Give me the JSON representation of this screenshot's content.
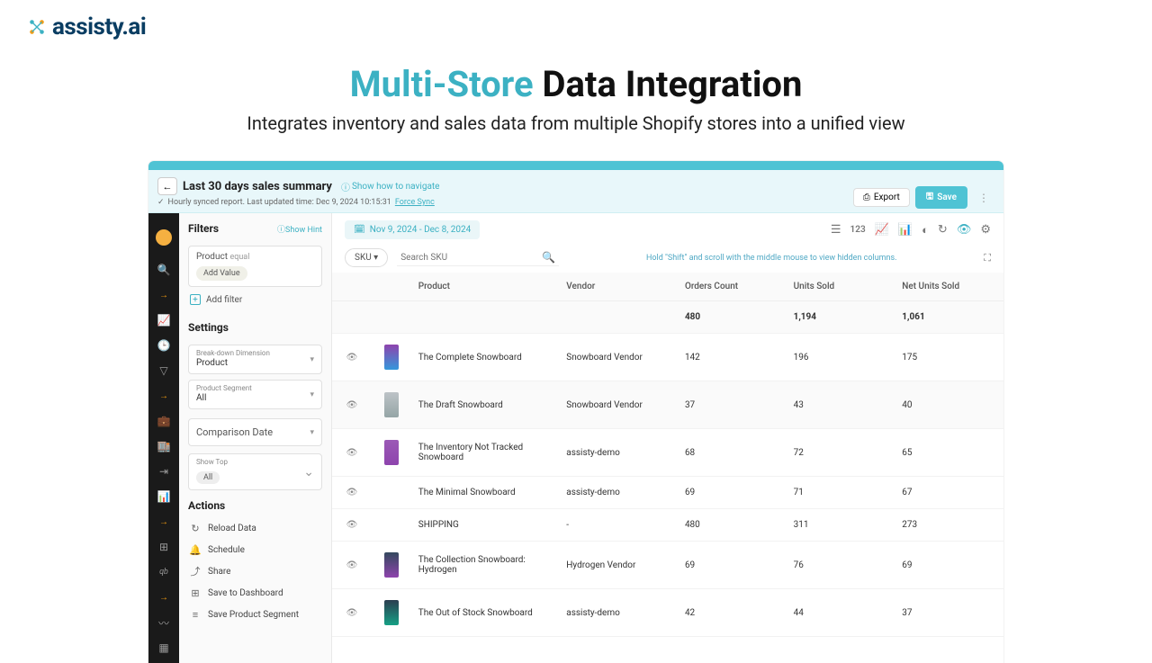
{
  "logo": {
    "text": "assisty",
    "suffix": ".ai"
  },
  "hero": {
    "title_accent": "Multi-Store",
    "title_rest": " Data Integration",
    "subtitle": "Integrates inventory and sales data from multiple Shopify stores into a unified view"
  },
  "report": {
    "title": "Last 30 days sales summary",
    "show_nav": "Show how to navigate",
    "sync_text": "Hourly synced report. Last updated time: Dec 9, 2024 10:15:31",
    "force_sync": "Force Sync",
    "export_label": "Export",
    "save_label": "Save"
  },
  "sidebar": {
    "filters_heading": "Filters",
    "show_hint": "Show Hint",
    "product_filter_label": "Product",
    "product_filter_eq": "equal",
    "add_value": "Add Value",
    "add_filter": "Add filter",
    "settings_heading": "Settings",
    "breakdown_label": "Break-down Dimension",
    "breakdown_value": "Product",
    "segment_label": "Product Segment",
    "segment_value": "All",
    "comparison_date": "Comparison Date",
    "show_top_label": "Show Top",
    "show_top_value": "All",
    "actions_heading": "Actions",
    "actions": [
      {
        "icon": "↻",
        "label": "Reload Data"
      },
      {
        "icon": "🔔",
        "label": "Schedule"
      },
      {
        "icon": "⤴",
        "label": "Share"
      },
      {
        "icon": "⊞",
        "label": "Save to Dashboard"
      },
      {
        "icon": "≡",
        "label": "Save Product Segment"
      }
    ]
  },
  "toolbar": {
    "date_range": "Nov 9, 2024 - Dec 8, 2024",
    "view_num": "123",
    "sku_label": "SKU ▾",
    "search_placeholder": "Search SKU",
    "hint": "Hold \"Shift\" and scroll with the middle mouse to view hidden columns."
  },
  "table": {
    "headers": [
      "Product",
      "Vendor",
      "Orders Count",
      "Units Sold",
      "Net Units Sold"
    ],
    "summary": {
      "orders": "480",
      "units": "1,194",
      "net": "1,061"
    },
    "rows": [
      {
        "product": "The Complete Snowboard",
        "vendor": "Snowboard Vendor",
        "orders": "142",
        "units": "196",
        "net": "175",
        "img": "p1"
      },
      {
        "product": "The Draft Snowboard",
        "vendor": "Snowboard Vendor",
        "orders": "37",
        "units": "43",
        "net": "40",
        "img": "p2",
        "alt": true
      },
      {
        "product": "The Inventory Not Tracked Snowboard",
        "vendor": "assisty-demo",
        "orders": "68",
        "units": "72",
        "net": "65",
        "img": "p3"
      },
      {
        "product": "The Minimal Snowboard",
        "vendor": "assisty-demo",
        "orders": "69",
        "units": "71",
        "net": "67",
        "img": "",
        "noimg": true
      },
      {
        "product": "SHIPPING",
        "vendor": "-",
        "orders": "480",
        "units": "311",
        "net": "273",
        "img": "",
        "noimg": true
      },
      {
        "product": "The Collection Snowboard: Hydrogen",
        "vendor": "Hydrogen Vendor",
        "orders": "69",
        "units": "76",
        "net": "69",
        "img": "p6"
      },
      {
        "product": "The Out of Stock Snowboard",
        "vendor": "assisty-demo",
        "orders": "42",
        "units": "44",
        "net": "37",
        "img": "p7"
      }
    ]
  }
}
